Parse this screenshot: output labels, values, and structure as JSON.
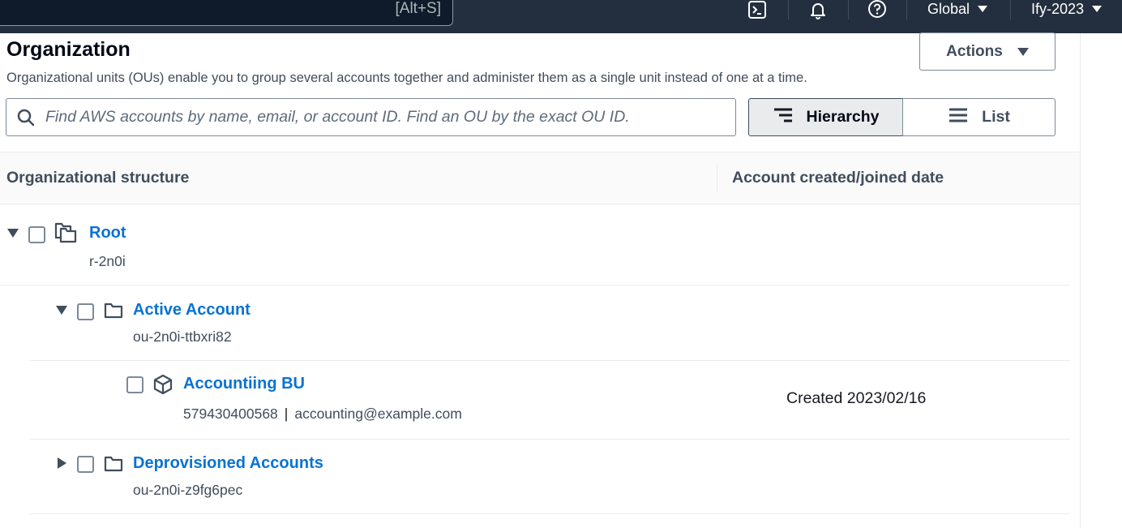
{
  "topnav": {
    "search_shortcut": "[Alt+S]",
    "icons": [
      "cloudshell-icon",
      "bell-icon",
      "help-icon"
    ],
    "region_label": "Global",
    "account_label": "Ify-2023"
  },
  "header": {
    "title": "Organization",
    "description": "Organizational units (OUs) enable you to group several accounts together and administer them as a single unit instead of one at a time.",
    "actions_label": "Actions"
  },
  "search": {
    "placeholder": "Find AWS accounts by name, email, or account ID. Find an OU by the exact OU ID."
  },
  "view_toggle": {
    "options": [
      {
        "label": "Hierarchy",
        "icon": "hierarchy-icon",
        "selected": true
      },
      {
        "label": "List",
        "icon": "list-icon",
        "selected": false
      }
    ]
  },
  "table": {
    "columns": [
      "Organizational structure",
      "Account created/joined date"
    ],
    "rows": [
      {
        "type": "root",
        "name": "Root",
        "id": "r-2n0i",
        "expanded": true,
        "icon": "root-folders-icon"
      },
      {
        "type": "ou",
        "name": "Active Account",
        "id": "ou-2n0i-ttbxri82",
        "expanded": true,
        "icon": "folder-icon"
      },
      {
        "type": "account",
        "name": "Accountiing BU",
        "account_id": "579430400568",
        "email": "accounting@example.com",
        "created": "Created 2023/02/16",
        "icon": "cube-icon"
      },
      {
        "type": "ou",
        "name": "Deprovisioned Accounts",
        "id": "ou-2n0i-z9fg6pec",
        "expanded": false,
        "icon": "folder-icon"
      }
    ]
  },
  "colors": {
    "nav_bg": "#232f3e",
    "link": "#0972d3",
    "text_secondary": "#414d5c"
  }
}
